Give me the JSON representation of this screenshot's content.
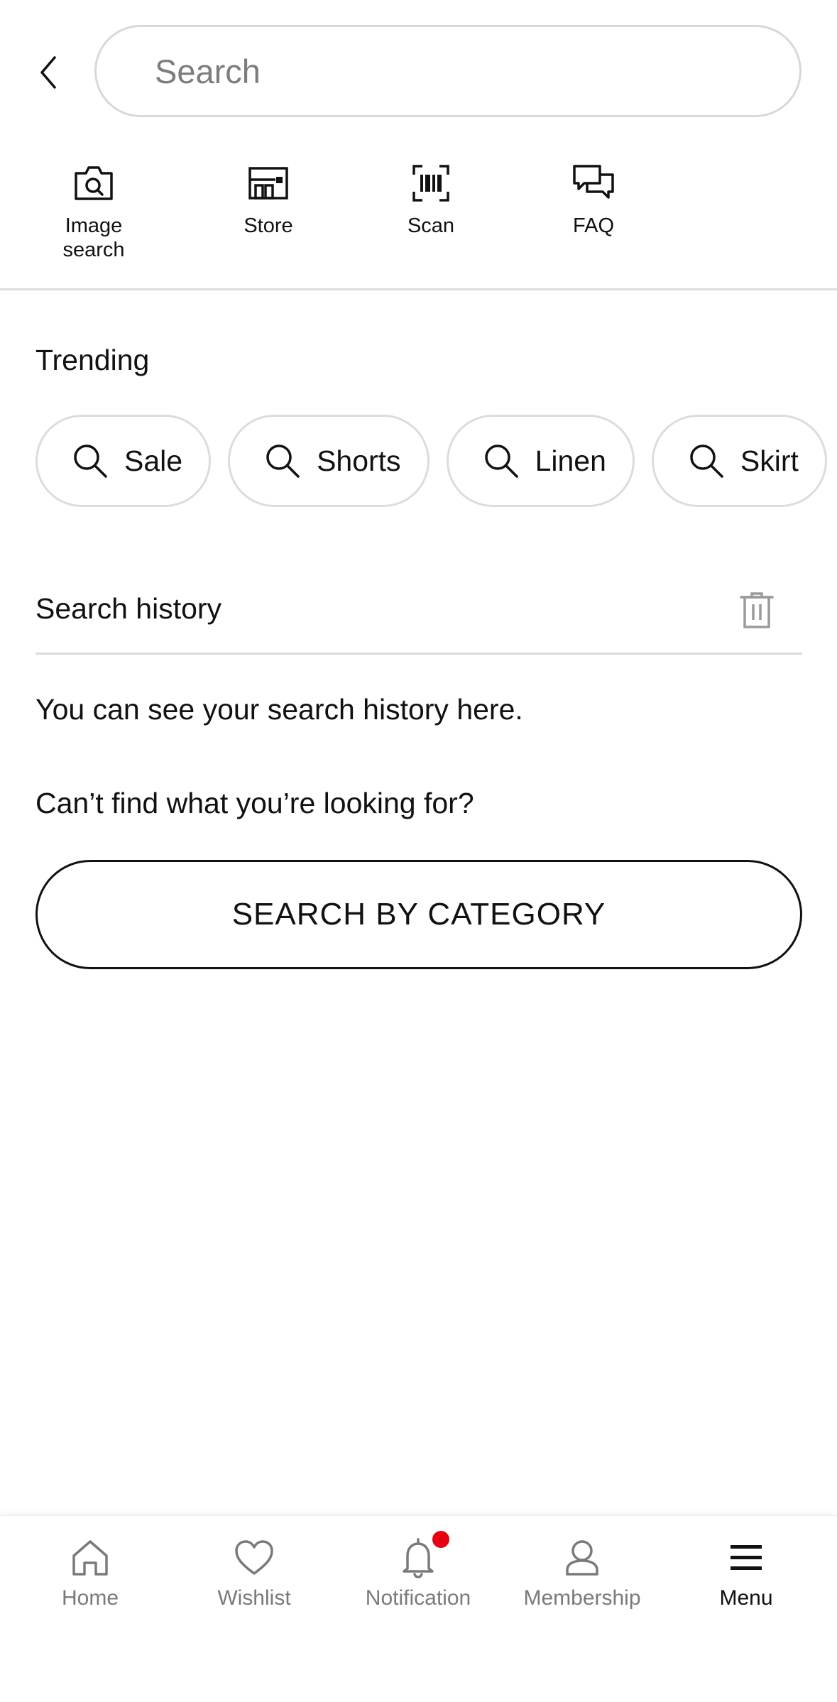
{
  "header": {
    "back_icon": "chevron-left-icon",
    "search_placeholder": "Search"
  },
  "quick_actions": [
    {
      "label": "Image\nsearch",
      "icon": "camera-search-icon"
    },
    {
      "label": "Store",
      "icon": "store-icon"
    },
    {
      "label": "Scan",
      "icon": "barcode-scan-icon"
    },
    {
      "label": "FAQ",
      "icon": "chat-bubbles-icon"
    }
  ],
  "trending": {
    "title": "Trending",
    "chips": [
      {
        "label": "Sale",
        "icon": "search-icon"
      },
      {
        "label": "Shorts",
        "icon": "search-icon"
      },
      {
        "label": "Linen",
        "icon": "search-icon"
      },
      {
        "label": "Skirt",
        "icon": "search-icon"
      }
    ]
  },
  "history": {
    "title": "Search history",
    "clear_icon": "trash-icon",
    "empty_text": "You can see your search history here."
  },
  "category": {
    "prompt": "Can’t find what you’re looking for?",
    "button_label": "SEARCH BY CATEGORY"
  },
  "bottom_nav": {
    "items": [
      {
        "label": "Home",
        "icon": "home-icon",
        "active": false
      },
      {
        "label": "Wishlist",
        "icon": "heart-icon",
        "active": false
      },
      {
        "label": "Notification",
        "icon": "bell-icon",
        "active": false,
        "badge": true
      },
      {
        "label": "Membership",
        "icon": "person-icon",
        "active": false
      },
      {
        "label": "Menu",
        "icon": "menu-icon",
        "active": true
      }
    ]
  },
  "colors": {
    "badge": "#e60012",
    "border": "#dcdcdc",
    "text": "#111111",
    "inactive_nav": "#7a7a7a"
  }
}
